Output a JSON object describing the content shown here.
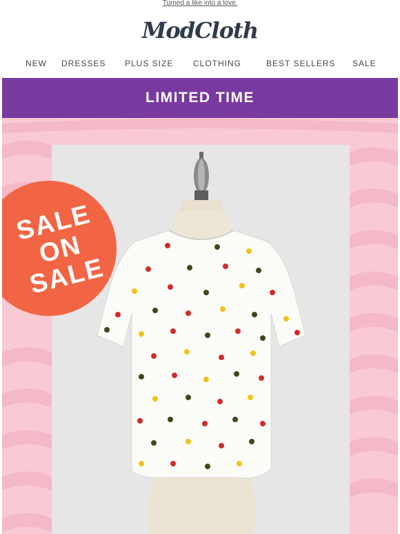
{
  "preheader": {
    "link_text": "Turned a like into a love."
  },
  "brand": {
    "logo_text": "ModCloth"
  },
  "nav": {
    "items": [
      {
        "label": "NEW"
      },
      {
        "label": "DRESSES"
      },
      {
        "label": "PLUS SIZE"
      },
      {
        "label": "CLOTHING"
      },
      {
        "label": "BEST SELLERS"
      },
      {
        "label": "SALE"
      }
    ]
  },
  "banner": {
    "text": "LIMITED TIME",
    "color": "#793a9f"
  },
  "hero": {
    "background_color": "#f9c9d4",
    "badge": {
      "lines": [
        "SALE",
        "ON",
        "SALE"
      ],
      "color": "#f26544"
    },
    "product": {
      "description": "white short-sleeve top with ladybug print on dress form"
    }
  }
}
